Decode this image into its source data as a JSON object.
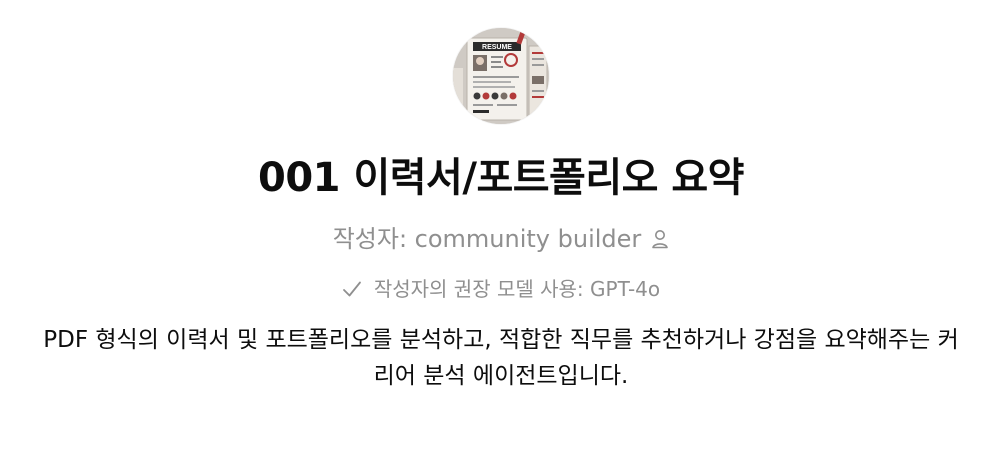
{
  "gpt": {
    "avatar_icon": "resume-document-icon",
    "avatar_caption": "RESUME",
    "title": "001 이력서/포트폴리오 요약",
    "author_label": "작성자: community builder",
    "author_icon": "person-icon",
    "model_icon": "check-icon",
    "recommended_model": "작성자의 권장 모델 사용: GPT-4o",
    "description": "PDF 형식의 이력서 및 포트폴리오를 분석하고, 적합한 직무를 추천하거나 강점을 요약해주는 커리어 분석 에이전트입니다."
  },
  "colors": {
    "title": "#0d0d0d",
    "muted": "#8f8f8f",
    "background": "#ffffff"
  }
}
